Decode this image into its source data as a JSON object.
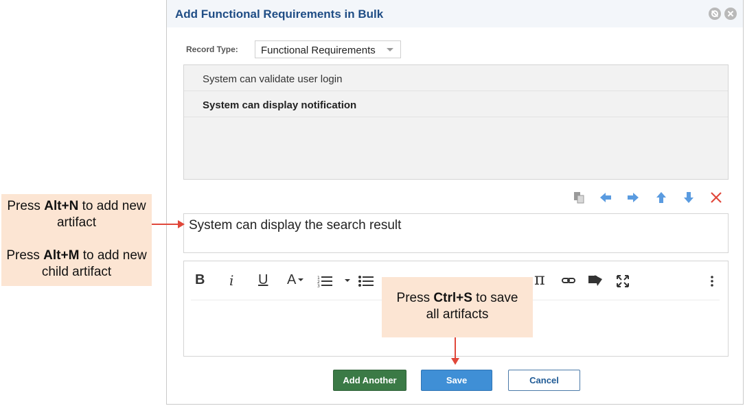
{
  "dialog": {
    "title": "Add Functional Requirements in Bulk"
  },
  "record_type": {
    "label": "Record Type:",
    "value": "Functional Requirements"
  },
  "artifacts": [
    {
      "text": "System can validate user login",
      "bold": false
    },
    {
      "text": "System can display notification",
      "bold": true
    }
  ],
  "toolbar_icons": [
    "paste-icon",
    "arrow-left-icon",
    "arrow-right-icon",
    "arrow-up-icon",
    "arrow-down-icon",
    "delete-icon"
  ],
  "input": {
    "value": "System can display the search result"
  },
  "editor_toolbar": {
    "bold": "B",
    "italic": "i",
    "underline": "U",
    "font": "A",
    "pi": "π"
  },
  "buttons": {
    "add_another": "Add Another",
    "save": "Save",
    "cancel": "Cancel"
  },
  "callouts": {
    "alt_n": {
      "pre": "Press ",
      "key": "Alt+N",
      "post": " to add new artifact"
    },
    "alt_m": {
      "pre": "Press ",
      "key": "Alt+M",
      "post": " to add new child artifact"
    },
    "ctrl_s": {
      "pre": "Press ",
      "key": "Ctrl+S",
      "post": " to save all artifacts"
    }
  },
  "colors": {
    "title": "#1f4d85",
    "add_button": "#3b7a46",
    "save_button": "#3f8fd6",
    "callout_bg": "#fce5d3",
    "arrow": "#e0473a",
    "nav_arrow": "#5a9be0",
    "delete": "#e0473a"
  }
}
